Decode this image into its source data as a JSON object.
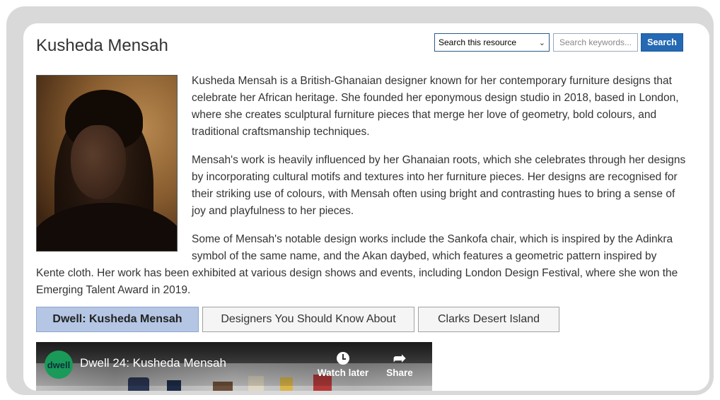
{
  "page": {
    "title": "Kusheda Mensah"
  },
  "search": {
    "scope_selected": "Search this resource",
    "placeholder": "Search keywords...",
    "button_label": "Search"
  },
  "article": {
    "image_alt": "Portrait of Kusheda Mensah",
    "paragraphs": [
      "Kusheda Mensah is a British-Ghanaian designer known for her contemporary furniture designs that celebrate her African heritage. She founded her eponymous design studio in 2018, based in London, where she creates sculptural furniture pieces that merge her love of geometry, bold colours, and traditional craftsmanship techniques.",
      "Mensah's work is heavily influenced by her Ghanaian roots, which she celebrates through her designs by incorporating cultural motifs and textures into her furniture pieces. Her designs are recognised for their striking use of colours, with Mensah often using bright and contrasting hues to bring a sense of joy and playfulness to her pieces.",
      "Some of Mensah's notable design works include the Sankofa chair, which is inspired by the Adinkra symbol of the same name, and the Akan daybed, which features a geometric pattern inspired by Kente cloth. Her work has been exhibited at various design shows and events, including London Design Festival, where she won the Emerging Talent Award in 2019."
    ]
  },
  "tabs": [
    {
      "label": "Dwell: Kusheda Mensah",
      "active": true
    },
    {
      "label": "Designers You Should Know About",
      "active": false
    },
    {
      "label": "Clarks Desert Island",
      "active": false
    }
  ],
  "video": {
    "channel_logo_text": "dwell",
    "title": "Dwell 24: Kusheda Mensah",
    "watch_later_label": "Watch later",
    "share_label": "Share"
  }
}
